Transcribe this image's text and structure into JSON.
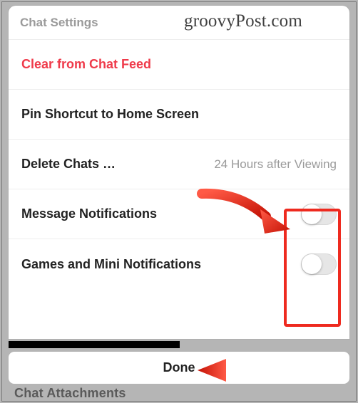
{
  "watermark": "groovyPost.com",
  "header": {
    "title": "Chat Settings"
  },
  "rows": {
    "clear": {
      "label": "Clear from Chat Feed"
    },
    "pin": {
      "label": "Pin Shortcut to Home Screen"
    },
    "delete": {
      "label": "Delete Chats …",
      "value": "24 Hours after Viewing"
    },
    "msg_notif": {
      "label": "Message Notifications",
      "toggle": false
    },
    "games_notif": {
      "label": "Games and Mini Notifications",
      "toggle": false
    }
  },
  "obscured_row": {
    "label": "Chat Attachments"
  },
  "done": {
    "label": "Done"
  }
}
